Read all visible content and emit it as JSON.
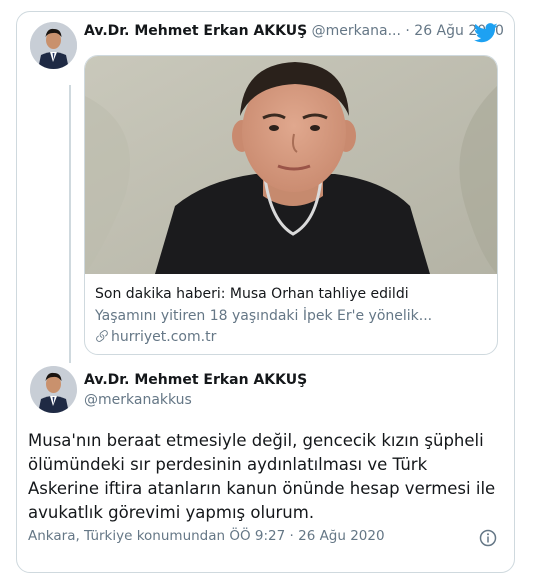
{
  "quoted_tweet": {
    "author_name": "Av.Dr. Mehmet Erkan AKKUŞ",
    "author_handle": "@merkana...",
    "separator": "·",
    "date": "26 Ağu 2020",
    "link_card": {
      "title": "Son dakika haberi: Musa Orhan tahliye edildi",
      "description": "Yaşamını yitiren 18 yaşındaki İpek Er'e yönelik...",
      "domain": "hurriyet.com.tr"
    }
  },
  "main_tweet": {
    "author_name": "Av.Dr. Mehmet Erkan AKKUŞ",
    "author_handle": "@merkanakkus",
    "text_lines": [
      "Musa'nın beraat etmesiyle değil, gencecik kızın şüpheli",
      "ölümündeki sır perdesinin aydınlatılması ve Türk",
      "Askerine iftira atanların kanun önünde hesap vermesi ile",
      "avukatlık görevimi yapmış olurum."
    ],
    "meta": "Ankara, Türkiye konumundan ÖÖ 9:27 · 26 Ağu 2020"
  },
  "colors": {
    "twitter_blue": "#1da1f2",
    "text": "#14171a",
    "muted": "#657786",
    "border": "#cfd9de"
  },
  "icons": [
    "twitter-bird-icon",
    "link-icon",
    "info-icon"
  ]
}
